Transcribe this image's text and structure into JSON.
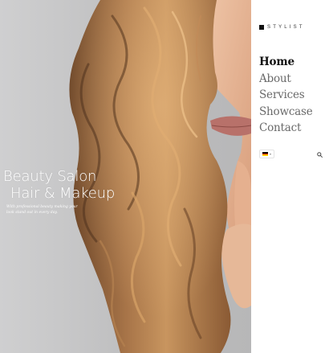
{
  "hero": {
    "title_line1": "Beauty Salon",
    "title_line2": "Hair & Makeup",
    "subtitle": "With professional beauty making your look stand out in every day."
  },
  "brand": {
    "logo_text": "STYLIST",
    "logo_color": "#111111"
  },
  "nav": {
    "items": [
      {
        "label": "Home",
        "active": true
      },
      {
        "label": "About",
        "active": false
      },
      {
        "label": "Services",
        "active": false
      },
      {
        "label": "Showcase",
        "active": false
      },
      {
        "label": "Contact",
        "active": false
      }
    ]
  },
  "language": {
    "flag": "de-flag-icon",
    "flag_colors": [
      "#000000",
      "#dd0000",
      "#ffce00"
    ]
  },
  "search": {
    "icon": "search-icon"
  },
  "colors": {
    "nav_active": "#111111",
    "nav_inactive": "#6a6a6a",
    "hair": "#9a6a43"
  }
}
